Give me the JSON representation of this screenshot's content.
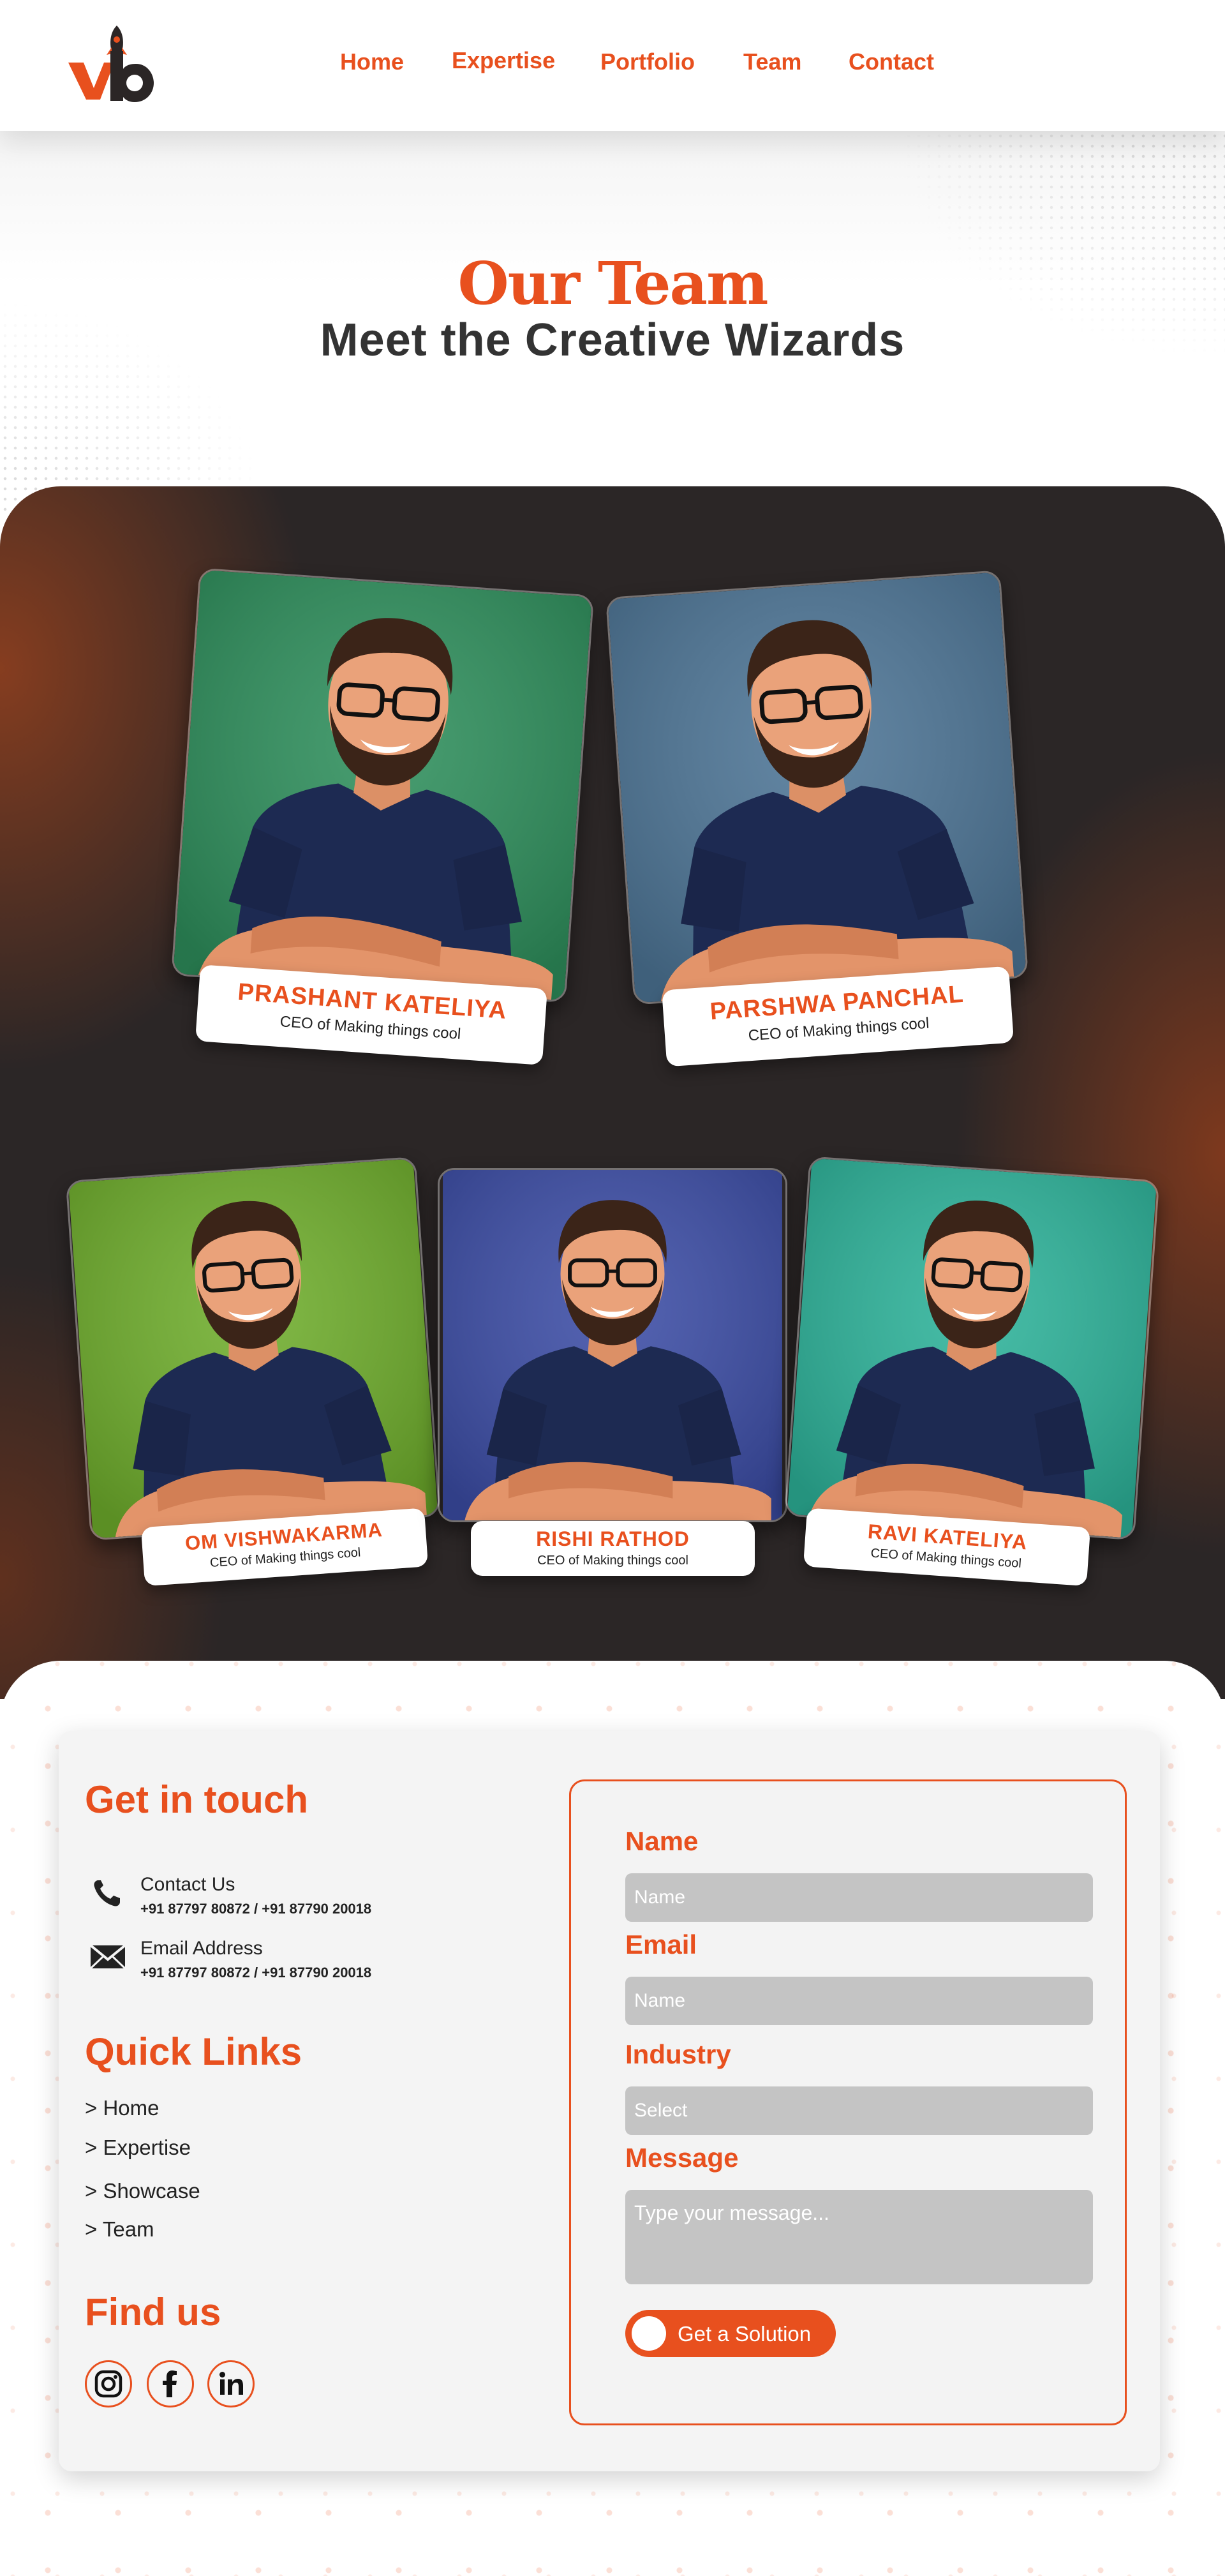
{
  "brand": {
    "logo_text": "Vb",
    "accent_color": "#e8501e"
  },
  "nav": {
    "items": [
      {
        "label": "Home"
      },
      {
        "label": "Expertise"
      },
      {
        "label": "Portfolio"
      },
      {
        "label": "Team"
      },
      {
        "label": "Contact"
      }
    ]
  },
  "hero": {
    "title": "Our Team",
    "subtitle": "Meet the Creative Wizards"
  },
  "team": {
    "members": [
      {
        "name": "PRASHANT KATELIYA",
        "role": "CEO of Making things cool",
        "bg_color": "#2e8f5c"
      },
      {
        "name": "PARSHWA PANCHAL",
        "role": "CEO of Making things cool",
        "bg_color": "#4d7596"
      },
      {
        "name": "OM VISHWAKARMA",
        "role": "CEO of Making things cool",
        "bg_color": "#6fae2c"
      },
      {
        "name": "RISHI RATHOD",
        "role": "CEO of Making things cool",
        "bg_color": "#3c4da6"
      },
      {
        "name": "RAVI KATELIYA",
        "role": "CEO of Making things cool",
        "bg_color": "#2db39a"
      }
    ]
  },
  "contact": {
    "get_in_touch_heading": "Get in touch",
    "phone": {
      "icon": "phone-icon",
      "label": "Contact Us",
      "value": "+91 87797 80872 / +91 87790 20018"
    },
    "email": {
      "icon": "mail-icon",
      "label": "Email Address",
      "value": "+91 87797 80872 / +91 87790 20018"
    },
    "quick_links_heading": "Quick Links",
    "quick_links": [
      "> Home",
      "> Expertise",
      "> Showcase",
      "> Team"
    ],
    "find_us_heading": "Find us",
    "socials": [
      "instagram-icon",
      "facebook-icon",
      "linkedin-icon"
    ]
  },
  "form": {
    "name_label": "Name",
    "name_placeholder": "Name",
    "email_label": "Email",
    "email_placeholder": "Name",
    "industry_label": "Industry",
    "industry_selected": "Select",
    "message_label": "Message",
    "message_placeholder": "Type your message...",
    "submit_label": "Get a Solution"
  }
}
